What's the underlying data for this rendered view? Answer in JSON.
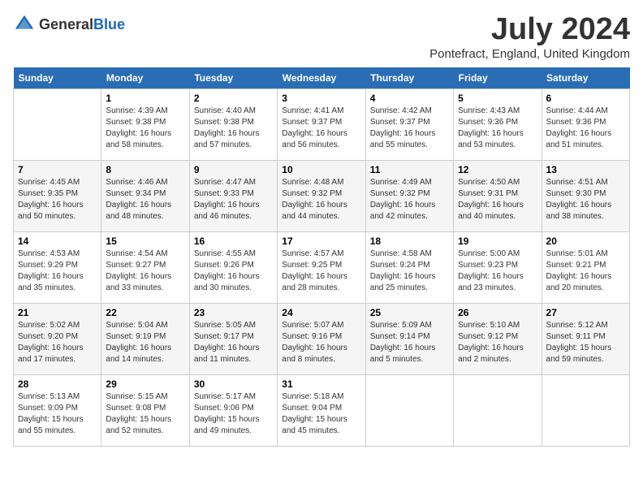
{
  "logo": {
    "general": "General",
    "blue": "Blue"
  },
  "title": "July 2024",
  "location": "Pontefract, England, United Kingdom",
  "days_of_week": [
    "Sunday",
    "Monday",
    "Tuesday",
    "Wednesday",
    "Thursday",
    "Friday",
    "Saturday"
  ],
  "weeks": [
    [
      {
        "day": "",
        "info": ""
      },
      {
        "day": "1",
        "info": "Sunrise: 4:39 AM\nSunset: 9:38 PM\nDaylight: 16 hours\nand 58 minutes."
      },
      {
        "day": "2",
        "info": "Sunrise: 4:40 AM\nSunset: 9:38 PM\nDaylight: 16 hours\nand 57 minutes."
      },
      {
        "day": "3",
        "info": "Sunrise: 4:41 AM\nSunset: 9:37 PM\nDaylight: 16 hours\nand 56 minutes."
      },
      {
        "day": "4",
        "info": "Sunrise: 4:42 AM\nSunset: 9:37 PM\nDaylight: 16 hours\nand 55 minutes."
      },
      {
        "day": "5",
        "info": "Sunrise: 4:43 AM\nSunset: 9:36 PM\nDaylight: 16 hours\nand 53 minutes."
      },
      {
        "day": "6",
        "info": "Sunrise: 4:44 AM\nSunset: 9:36 PM\nDaylight: 16 hours\nand 51 minutes."
      }
    ],
    [
      {
        "day": "7",
        "info": "Sunrise: 4:45 AM\nSunset: 9:35 PM\nDaylight: 16 hours\nand 50 minutes."
      },
      {
        "day": "8",
        "info": "Sunrise: 4:46 AM\nSunset: 9:34 PM\nDaylight: 16 hours\nand 48 minutes."
      },
      {
        "day": "9",
        "info": "Sunrise: 4:47 AM\nSunset: 9:33 PM\nDaylight: 16 hours\nand 46 minutes."
      },
      {
        "day": "10",
        "info": "Sunrise: 4:48 AM\nSunset: 9:32 PM\nDaylight: 16 hours\nand 44 minutes."
      },
      {
        "day": "11",
        "info": "Sunrise: 4:49 AM\nSunset: 9:32 PM\nDaylight: 16 hours\nand 42 minutes."
      },
      {
        "day": "12",
        "info": "Sunrise: 4:50 AM\nSunset: 9:31 PM\nDaylight: 16 hours\nand 40 minutes."
      },
      {
        "day": "13",
        "info": "Sunrise: 4:51 AM\nSunset: 9:30 PM\nDaylight: 16 hours\nand 38 minutes."
      }
    ],
    [
      {
        "day": "14",
        "info": "Sunrise: 4:53 AM\nSunset: 9:29 PM\nDaylight: 16 hours\nand 35 minutes."
      },
      {
        "day": "15",
        "info": "Sunrise: 4:54 AM\nSunset: 9:27 PM\nDaylight: 16 hours\nand 33 minutes."
      },
      {
        "day": "16",
        "info": "Sunrise: 4:55 AM\nSunset: 9:26 PM\nDaylight: 16 hours\nand 30 minutes."
      },
      {
        "day": "17",
        "info": "Sunrise: 4:57 AM\nSunset: 9:25 PM\nDaylight: 16 hours\nand 28 minutes."
      },
      {
        "day": "18",
        "info": "Sunrise: 4:58 AM\nSunset: 9:24 PM\nDaylight: 16 hours\nand 25 minutes."
      },
      {
        "day": "19",
        "info": "Sunrise: 5:00 AM\nSunset: 9:23 PM\nDaylight: 16 hours\nand 23 minutes."
      },
      {
        "day": "20",
        "info": "Sunrise: 5:01 AM\nSunset: 9:21 PM\nDaylight: 16 hours\nand 20 minutes."
      }
    ],
    [
      {
        "day": "21",
        "info": "Sunrise: 5:02 AM\nSunset: 9:20 PM\nDaylight: 16 hours\nand 17 minutes."
      },
      {
        "day": "22",
        "info": "Sunrise: 5:04 AM\nSunset: 9:19 PM\nDaylight: 16 hours\nand 14 minutes."
      },
      {
        "day": "23",
        "info": "Sunrise: 5:05 AM\nSunset: 9:17 PM\nDaylight: 16 hours\nand 11 minutes."
      },
      {
        "day": "24",
        "info": "Sunrise: 5:07 AM\nSunset: 9:16 PM\nDaylight: 16 hours\nand 8 minutes."
      },
      {
        "day": "25",
        "info": "Sunrise: 5:09 AM\nSunset: 9:14 PM\nDaylight: 16 hours\nand 5 minutes."
      },
      {
        "day": "26",
        "info": "Sunrise: 5:10 AM\nSunset: 9:12 PM\nDaylight: 16 hours\nand 2 minutes."
      },
      {
        "day": "27",
        "info": "Sunrise: 5:12 AM\nSunset: 9:11 PM\nDaylight: 15 hours\nand 59 minutes."
      }
    ],
    [
      {
        "day": "28",
        "info": "Sunrise: 5:13 AM\nSunset: 9:09 PM\nDaylight: 15 hours\nand 55 minutes."
      },
      {
        "day": "29",
        "info": "Sunrise: 5:15 AM\nSunset: 9:08 PM\nDaylight: 15 hours\nand 52 minutes."
      },
      {
        "day": "30",
        "info": "Sunrise: 5:17 AM\nSunset: 9:06 PM\nDaylight: 15 hours\nand 49 minutes."
      },
      {
        "day": "31",
        "info": "Sunrise: 5:18 AM\nSunset: 9:04 PM\nDaylight: 15 hours\nand 45 minutes."
      },
      {
        "day": "",
        "info": ""
      },
      {
        "day": "",
        "info": ""
      },
      {
        "day": "",
        "info": ""
      }
    ]
  ]
}
